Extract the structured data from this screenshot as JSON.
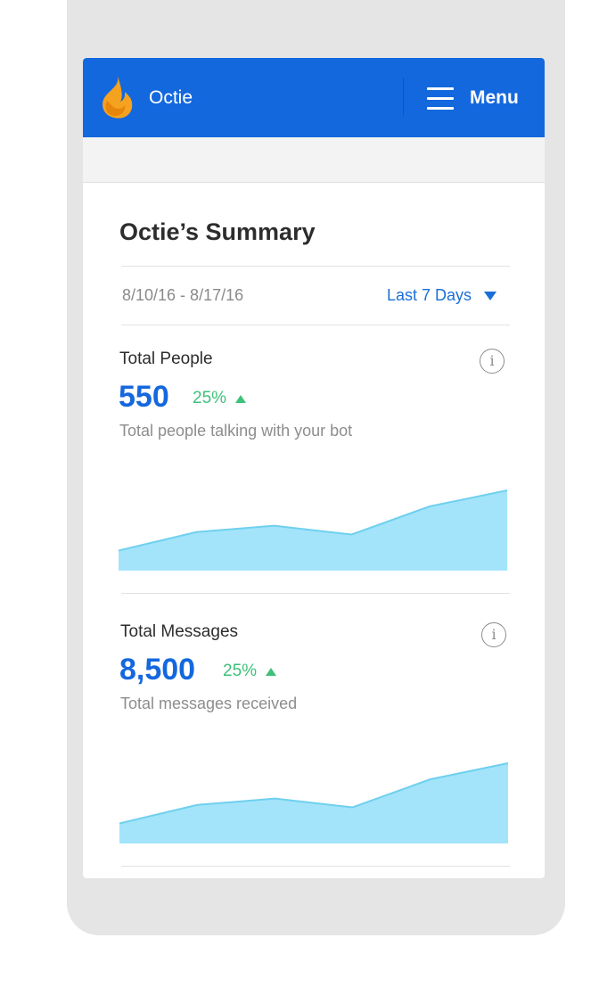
{
  "app": {
    "name": "Octie",
    "menu_label": "Menu"
  },
  "summary": {
    "title": "Octie’s Summary",
    "date_range": "8/10/16 - 8/17/16",
    "period": "Last 7 Days"
  },
  "colors": {
    "brand": "#1468de",
    "accent_green": "#3fc07a",
    "chart_fill": "#a3e4fa",
    "chart_line": "#6fd0ee",
    "logo_orange": "#f5a21f"
  },
  "stats": [
    {
      "label": "Total People",
      "value": "550",
      "change": "25%",
      "description": "Total people talking with your bot",
      "info_icon": "info-icon"
    },
    {
      "label": "Total Messages",
      "value": "8,500",
      "change": "25%",
      "description": "Total messages received",
      "info_icon": "info-icon"
    }
  ],
  "chart_data": [
    {
      "type": "area",
      "series": [
        {
          "values": [
            0.25,
            0.48,
            0.56,
            0.45,
            0.8,
            1.0
          ]
        }
      ]
    },
    {
      "type": "area",
      "series": [
        {
          "values": [
            0.25,
            0.48,
            0.56,
            0.45,
            0.8,
            1.0
          ]
        }
      ]
    }
  ]
}
